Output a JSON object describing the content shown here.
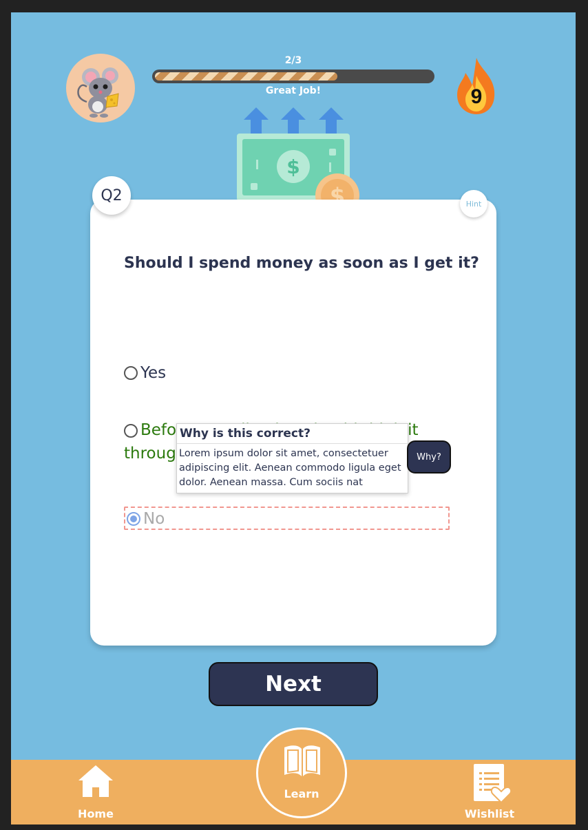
{
  "header": {
    "progress": {
      "label": "2/3",
      "fraction": 0.66,
      "caption": "Great Job!"
    },
    "streak": {
      "count": "9",
      "icon": "fire-icon"
    },
    "avatar": {
      "icon": "mouse-avatar"
    }
  },
  "card": {
    "badge": "Q2",
    "hint_label": "Hint",
    "question": "Should I spend money as soon as I get it?",
    "options": [
      {
        "label": "Yes"
      },
      {
        "label": "Before spending it, I should think it through"
      },
      {
        "label": "No",
        "selected": true
      }
    ],
    "popover": {
      "title": "Why is this correct?",
      "body": "Lorem ipsum dolor sit amet, consectetuer adipiscing elit. Aenean commodo ligula eget dolor. Aenean massa. Cum sociis nat"
    },
    "why_label": "Why?"
  },
  "next_label": "Next",
  "nav": {
    "items": [
      {
        "label": "Home",
        "icon": "home-icon"
      },
      {
        "label": "Learn",
        "icon": "book-icon"
      },
      {
        "label": "Wishlist",
        "icon": "wishlist-icon"
      }
    ]
  },
  "colors": {
    "background": "#76bce0",
    "primary": "#2d3452",
    "nav": "#efaf5f",
    "correct": "#2c7a0e",
    "selected_outline": "#f1968f"
  }
}
